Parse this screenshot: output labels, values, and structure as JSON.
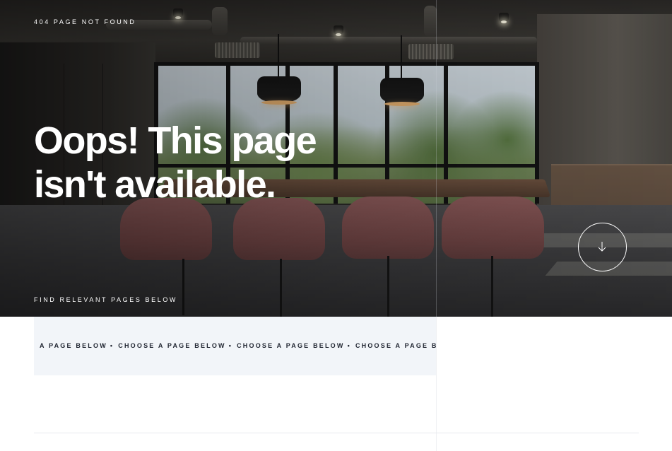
{
  "hero": {
    "eyebrow": "404 PAGE NOT FOUND",
    "headline": "Oops! This page isn't available.",
    "find_label": "FIND RELEVANT PAGES BELOW",
    "scroll_icon": "arrow-down-icon"
  },
  "marquee": {
    "items": [
      "A PAGE BELOW",
      "CHOOSE A PAGE BELOW",
      "CHOOSE A PAGE BELOW",
      "CHOOSE A PAGE BEL"
    ],
    "separator": "•"
  },
  "colors": {
    "hero_text": "#ffffff",
    "marquee_bg": "#f2f5f9",
    "marquee_text": "#1f2430"
  }
}
